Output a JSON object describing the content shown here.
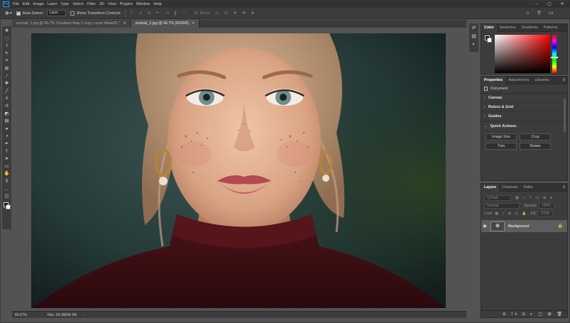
{
  "menu": {
    "logo": "Ps",
    "items": [
      "File",
      "Edit",
      "Image",
      "Layer",
      "Type",
      "Select",
      "Filter",
      "3D",
      "View",
      "Plugins",
      "Window",
      "Help"
    ],
    "minimize": "–",
    "maximize": "▢",
    "close": "✕"
  },
  "options": {
    "move_icon": "✥",
    "dropdown_icon": "▾",
    "auto_select_label": "Auto-Select:",
    "auto_select_target": "Layer",
    "transform_label": "Show Transform Controls",
    "align_icons": "⊤ ⊥ ≡ ⊢ ⊣ ∥ ⋯",
    "mode3d_label": "3D Mode:",
    "mode3d_icons": "◎ ⟳ ✥ ✤ ■",
    "home_icon": "⌂",
    "search_icon": "⚲",
    "workspace_icon": "▭"
  },
  "tabs": [
    {
      "label": "portrait_1.jpg @ 66.7% (Gradient Map 1 copy, Layer Mask/8) *",
      "close": "✕"
    },
    {
      "label": "portrait_2.jpg @ 66.7% (RGB/8)",
      "close": "✕"
    }
  ],
  "toolbar": {
    "tools": [
      {
        "name": "move-tool-icon",
        "glyph": "✥"
      },
      {
        "name": "marquee-tool-icon",
        "glyph": "⬚"
      },
      {
        "name": "lasso-tool-icon",
        "glyph": "ℓ"
      },
      {
        "name": "quick-select-tool-icon",
        "glyph": "✎"
      },
      {
        "name": "crop-tool-icon",
        "glyph": "⌗"
      },
      {
        "name": "frame-tool-icon",
        "glyph": "⊠"
      },
      {
        "name": "eyedropper-tool-icon",
        "glyph": "⁄"
      },
      {
        "name": "healing-tool-icon",
        "glyph": "✚"
      },
      {
        "name": "brush-tool-icon",
        "glyph": "╱"
      },
      {
        "name": "stamp-tool-icon",
        "glyph": "♙"
      },
      {
        "name": "history-brush-tool-icon",
        "glyph": "↺"
      },
      {
        "name": "eraser-tool-icon",
        "glyph": "◩"
      },
      {
        "name": "gradient-tool-icon",
        "glyph": "▤"
      },
      {
        "name": "blur-tool-icon",
        "glyph": "●"
      },
      {
        "name": "dodge-tool-icon",
        "glyph": "◑"
      },
      {
        "name": "pen-tool-icon",
        "glyph": "✒"
      },
      {
        "name": "type-tool-icon",
        "glyph": "T"
      },
      {
        "name": "path-select-tool-icon",
        "glyph": "➤"
      },
      {
        "name": "shape-tool-icon",
        "glyph": "▭"
      },
      {
        "name": "hand-tool-icon",
        "glyph": "✋"
      },
      {
        "name": "zoom-tool-icon",
        "glyph": "⚲"
      },
      {
        "name": "more-tools-icon",
        "glyph": "…"
      },
      {
        "name": "quick-mask-icon",
        "glyph": "◫"
      },
      {
        "name": "screen-mode-icon",
        "glyph": "▣"
      }
    ]
  },
  "status": {
    "zoom": "66.67%",
    "doc": "Doc: 34.1M/34.1M",
    "arrow": "›"
  },
  "sidestrip": {
    "icons": [
      "⇄",
      "▤",
      "◐"
    ]
  },
  "color_panel": {
    "tabs": [
      "Color",
      "Swatches",
      "Gradients",
      "Patterns"
    ],
    "menu_icon": "≡"
  },
  "properties_panel": {
    "tabs": [
      "Properties",
      "Adjustments",
      "Libraries"
    ],
    "menu_icon": "≡",
    "document_label": "Document",
    "sections": [
      "Canvas",
      "Rulers & Grid",
      "Guides",
      "Quick Actions"
    ],
    "chevron_collapsed": "›",
    "chevron_expanded": "⌄",
    "quick_actions": [
      "Image Size",
      "Crop",
      "Trim",
      "Rotate"
    ]
  },
  "layers_panel": {
    "tabs": [
      "Layers",
      "Channels",
      "Paths"
    ],
    "menu_icon": "≡",
    "kind_placeholder": "Q Kind",
    "filter_icons": "▣ ◐ T ▭ ⊞ ●",
    "blend_mode": "Normal",
    "opacity_label": "Opacity:",
    "opacity_value": "100%",
    "lock_label": "Lock:",
    "lock_icons": "▦ ╱ ✥ ⊡ 🔒",
    "fill_label": "Fill:",
    "fill_value": "100%",
    "layer_name": "Background",
    "eye_icon": "◉",
    "lock_icon": "🔒",
    "footer_icons": "⊖ fx ◘ ◐ ▢ ⊞ 🗑"
  }
}
